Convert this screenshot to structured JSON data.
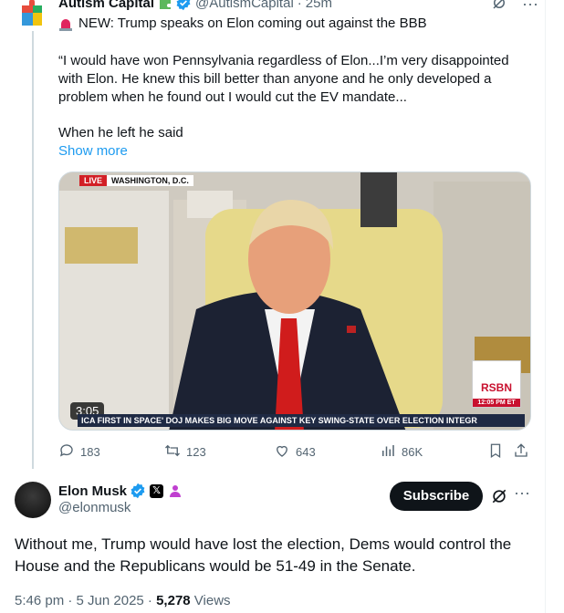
{
  "parent_tweet": {
    "author_name": "Autism Capital",
    "handle": "@AutismCapital",
    "time_ago": "25m",
    "headline": "NEW: Trump speaks on Elon coming out against the BBB",
    "quote_text": "“I would have won Pennsylvania regardless of Elon...I’m very disappointed with Elon. He knew this bill better than anyone and he only developed a problem when he found out I would cut the EV mandate...",
    "second_paragraph": "When he left he said",
    "show_more_label": "Show more",
    "video": {
      "live_label": "LIVE",
      "location_label": "WASHINGTON, D.C.",
      "duration": "3:05",
      "ticker_text": "ICA FIRST IN SPACE'   DOJ MAKES BIG MOVE AGAINST KEY SWING-STATE OVER ELECTION INTEGR",
      "network_logo": "RSBN",
      "network_time": "12:05 PM ET"
    },
    "stats": {
      "replies": "183",
      "reposts": "123",
      "likes": "643",
      "views": "86K"
    }
  },
  "main_tweet": {
    "author_name": "Elon Musk",
    "handle": "@elonmusk",
    "x_badge": "𝕏",
    "subscribe_label": "Subscribe",
    "text": "Without me, Trump would have lost the election, Dems would control the House and the Republicans would be 51-49 in the Senate.",
    "timestamp": "5:46 pm · 5 Jun 2025 · ",
    "views_count": "5,278",
    "views_label": " Views"
  },
  "colors": {
    "accent": "#1d9bf0",
    "text": "#0f1419",
    "muted": "#536471",
    "divider": "#cfd9de"
  }
}
